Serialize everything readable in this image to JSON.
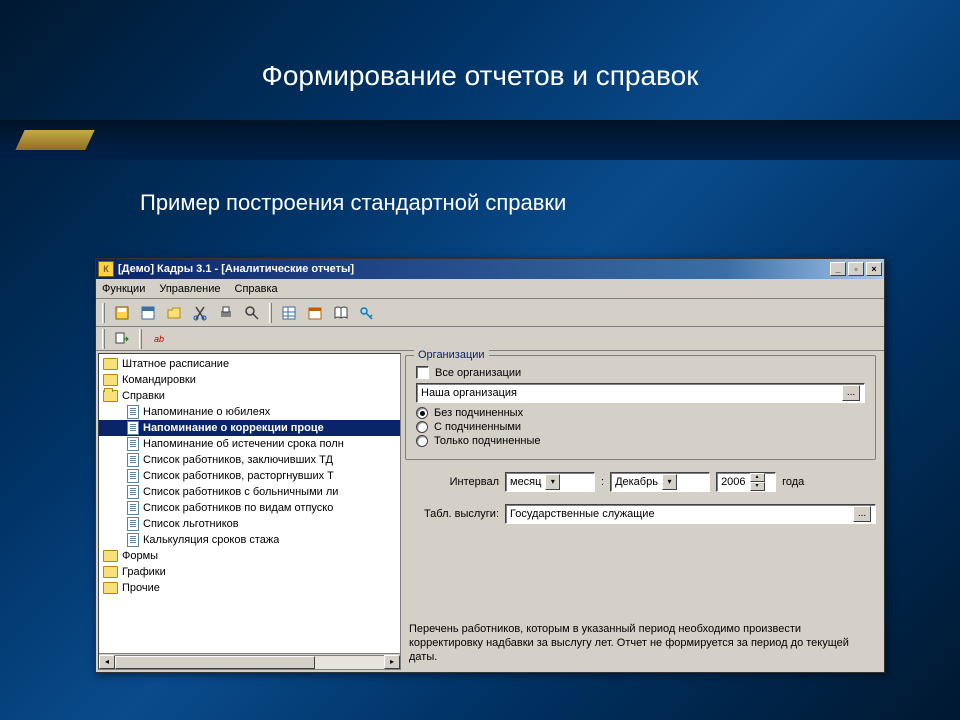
{
  "slide": {
    "title": "Формирование отчетов и справок",
    "subtitle": "Пример построения стандартной справки"
  },
  "app": {
    "title": "[Демо] Кадры 3.1 - [Аналитические отчеты]",
    "menu": {
      "functions": "Функции",
      "manage": "Управление",
      "help": "Справка"
    }
  },
  "tree": {
    "n0": "Штатное расписание",
    "n1": "Командировки",
    "n2": "Справки",
    "c0": "Напоминание о юбилеях",
    "c1": "Напоминание о коррекции проце",
    "c2": "Напоминание об истечении срока полн",
    "c3": "Список работников, заключивших ТД",
    "c4": "Список работников, расторгнувших Т",
    "c5": "Список работников с больничными ли",
    "c6": "Список работников по видам отпуско",
    "c7": "Список льготников",
    "c8": "Калькуляция сроков стажа",
    "n3": "Формы",
    "n4": "Графики",
    "n5": "Прочие"
  },
  "org": {
    "legend": "Организации",
    "all": "Все организации",
    "value": "Наша организация",
    "r0": "Без подчиненных",
    "r1": "С подчиненными",
    "r2": "Только подчиненные"
  },
  "interval": {
    "label": "Интервал",
    "unit": "месяц",
    "month": "Декабрь",
    "year": "2006",
    "year_suffix": "года"
  },
  "table": {
    "label": "Табл. выслуги:",
    "value": "Государственные служащие"
  },
  "desc": "Перечень работников, которым в указанный период необходимо произвести корректировку надбавки за выслугу лет. Отчет не формируется за период до текущей даты."
}
